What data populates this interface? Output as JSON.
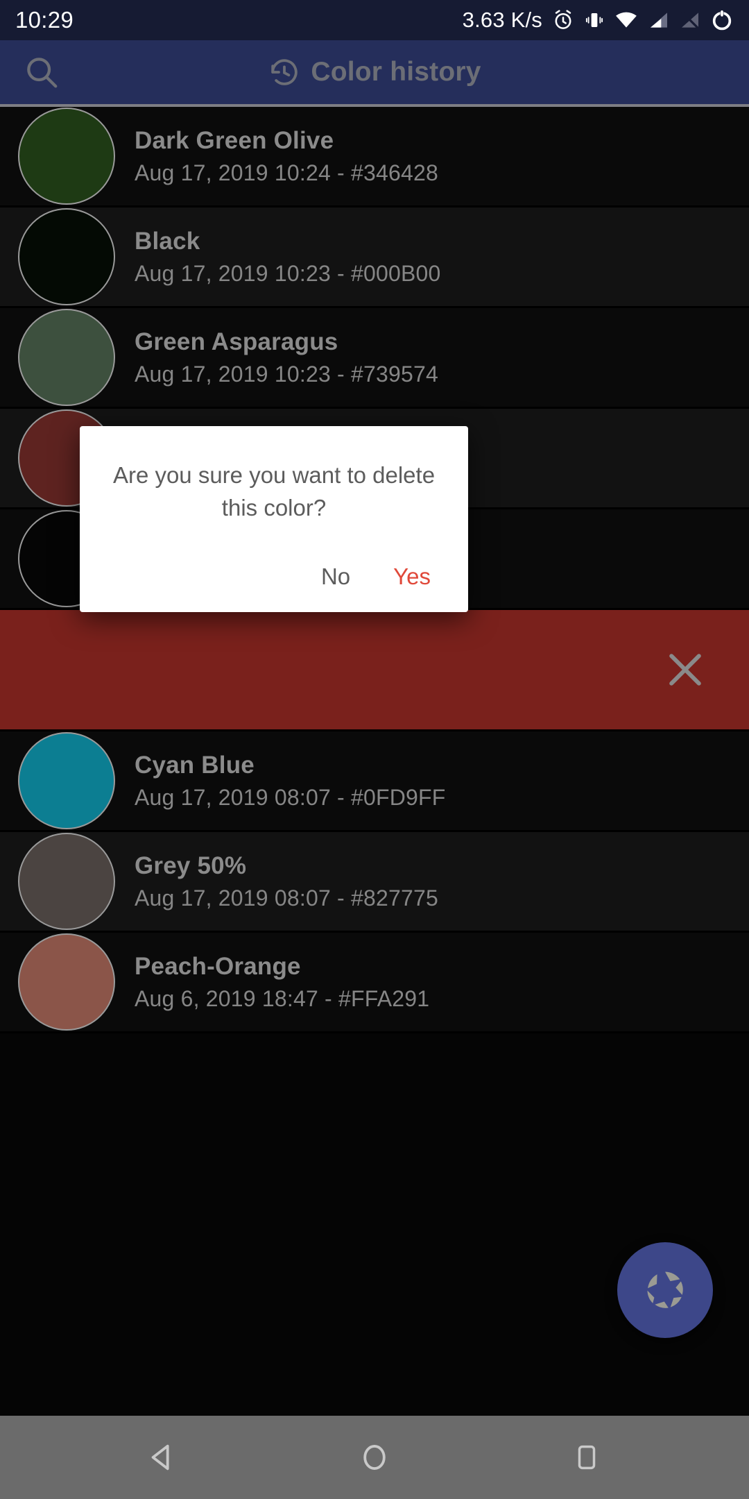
{
  "status_bar": {
    "clock": "10:29",
    "network_speed": "3.63 K/s",
    "icons": [
      "alarm-icon",
      "vibrate-icon",
      "wifi-icon",
      "signal-icon",
      "no-sim-icon",
      "battery-icon"
    ]
  },
  "app_bar": {
    "title": "Color history",
    "search_icon": "search-icon",
    "history_icon": "history-icon",
    "background": "#252E5B",
    "title_color": "#6C6E76"
  },
  "list": {
    "items": [
      {
        "name": "Dark Green Olive",
        "meta": "Aug 17, 2019 10:24 - #346428",
        "swatch": "#1E3A14",
        "alt": false
      },
      {
        "name": "Black",
        "meta": "Aug 17, 2019 10:23 - #000B00",
        "swatch": "#040A04",
        "alt": true
      },
      {
        "name": "Green Asparagus",
        "meta": "Aug 17, 2019 10:23 - #739574",
        "swatch": "#3D503E",
        "alt": false
      },
      {
        "name": "",
        "meta": "",
        "swatch": "#5E2320",
        "alt": true
      },
      {
        "name": "",
        "meta": "",
        "swatch": "#050505",
        "alt": false
      },
      {
        "name": "Cyan Blue",
        "meta": "Aug 17, 2019 08:07 - #0FD9FF",
        "swatch": "#0C7E92",
        "alt": false
      },
      {
        "name": "Grey 50%",
        "meta": "Aug 17, 2019 08:07 - #827775",
        "swatch": "#4B4441",
        "alt": true
      },
      {
        "name": "Peach-Orange",
        "meta": "Aug 6, 2019 18:47 - #FFA291",
        "swatch": "#8B5549",
        "alt": false
      }
    ],
    "delete_row": {
      "background": "#7A211C",
      "close_icon": "close-icon",
      "icon_color": "#8A8A8A"
    },
    "name_color": "#8B8B8B",
    "meta_color": "#868686"
  },
  "dialog": {
    "message": "Are you sure you want to delete this color?",
    "no_label": "No",
    "yes_label": "Yes",
    "no_color": "#5C5C5C",
    "yes_color": "#E0493A",
    "background": "#FFFFFF"
  },
  "fab": {
    "icon": "aperture-icon",
    "background": "#3D4789",
    "icon_color": "#9B9B93"
  },
  "nav_bar": {
    "background": "#6B6B6B",
    "buttons": [
      "back-button",
      "home-button",
      "recents-button"
    ]
  }
}
